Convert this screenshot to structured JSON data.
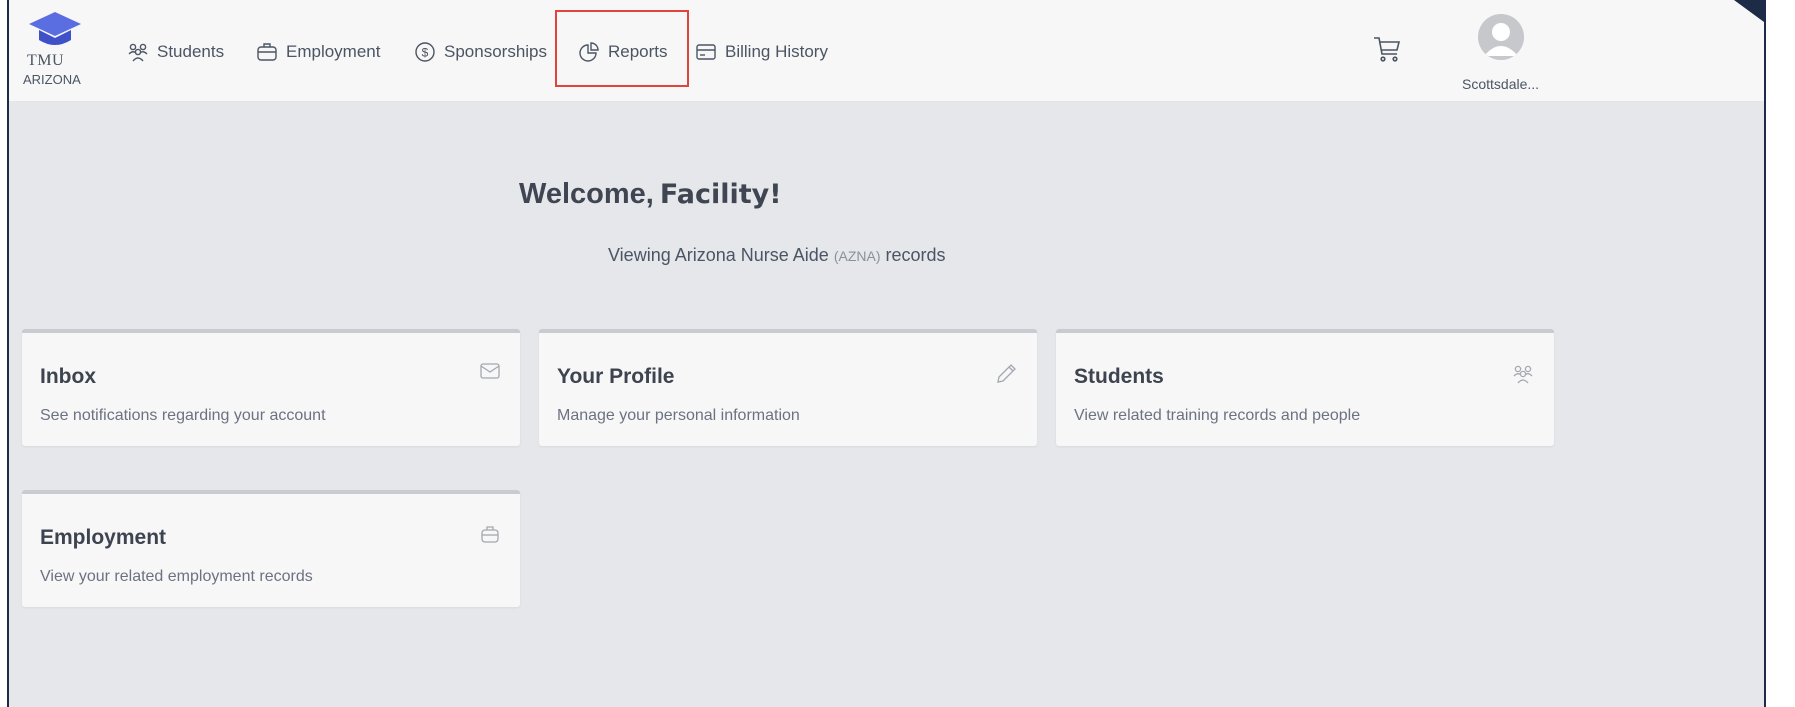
{
  "logo": {
    "line1": "TMU",
    "line2": "ARIZONA"
  },
  "nav": {
    "items": [
      {
        "label": "Students",
        "icon": "students-icon"
      },
      {
        "label": "Employment",
        "icon": "briefcase-icon"
      },
      {
        "label": "Sponsorships",
        "icon": "dollar-icon"
      },
      {
        "label": "Reports",
        "icon": "pie-chart-icon"
      },
      {
        "label": "Billing History",
        "icon": "billing-card-icon"
      }
    ],
    "highlighted": "Reports"
  },
  "user": {
    "name": "Scottsdale..."
  },
  "welcome": {
    "greeting": "Welcome,",
    "name": "Facility!",
    "sub_prefix": "Viewing Arizona Nurse Aide",
    "sub_code": "(AZNA)",
    "sub_suffix": "records"
  },
  "cards": [
    {
      "title": "Inbox",
      "desc": "See notifications regarding your account",
      "icon": "mail-icon"
    },
    {
      "title": "Your Profile",
      "desc": "Manage your personal information",
      "icon": "pencil-icon"
    },
    {
      "title": "Students",
      "desc": "View related training records and people",
      "icon": "students-icon"
    },
    {
      "title": "Employment",
      "desc": "View your related employment records",
      "icon": "briefcase-icon"
    }
  ],
  "colors": {
    "highlight": "#e0443a",
    "logo": "#5b6ee1",
    "frame": "#1e2b46"
  }
}
